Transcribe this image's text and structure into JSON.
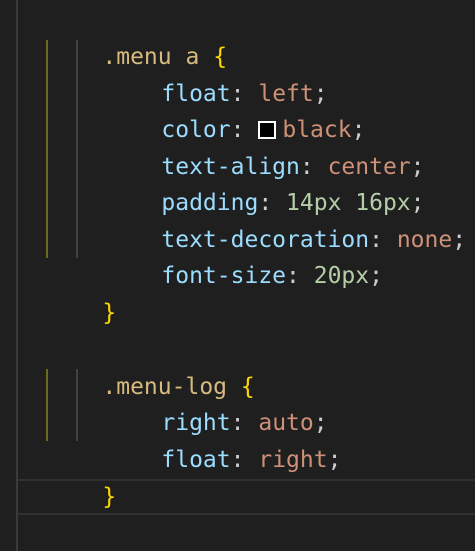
{
  "code": {
    "rule1": {
      "selector": ".menu a",
      "open_brace": "{",
      "close_brace": "}",
      "decls": [
        {
          "prop": "float",
          "value": "left"
        },
        {
          "prop": "color",
          "value": "black",
          "swatch_color": "#000000"
        },
        {
          "prop": "text-align",
          "value": "center"
        },
        {
          "prop": "padding",
          "value": "14px 16px"
        },
        {
          "prop": "text-decoration",
          "value": "none"
        },
        {
          "prop": "font-size",
          "value": "20px"
        }
      ]
    },
    "rule2": {
      "selector": ".menu-log",
      "open_brace": "{",
      "close_brace": "}",
      "decls": [
        {
          "prop": "right",
          "value": "auto"
        },
        {
          "prop": "float",
          "value": "right"
        }
      ]
    }
  },
  "colors": {
    "background": "#1f1f1f",
    "selector": "#d7ba7d",
    "brace": "#ffd700",
    "property": "#9cdcfe",
    "string_value": "#ce9178",
    "numeric_value": "#b5cea8"
  }
}
